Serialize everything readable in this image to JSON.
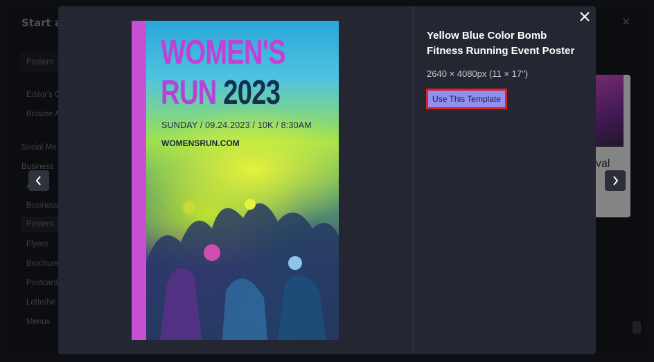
{
  "background": {
    "title": "Start a",
    "sidebar_items": [
      {
        "label": "Posters",
        "kind": "box"
      },
      {
        "label": "Editor's C"
      },
      {
        "label": "Browse A"
      },
      {
        "label": "Social Me",
        "kind": "section"
      },
      {
        "label": "Business",
        "kind": "section"
      },
      {
        "label": "A",
        "kind": "partial"
      },
      {
        "label": "Business"
      },
      {
        "label": "Posters",
        "kind": "active"
      },
      {
        "label": "Flyers"
      },
      {
        "label": "Brochure"
      },
      {
        "label": "Postcard"
      },
      {
        "label": "Letterhe"
      },
      {
        "label": "Menus"
      }
    ],
    "card_text": "val"
  },
  "modal": {
    "close_icon": "close-icon",
    "prev_icon": "chevron-left-icon",
    "next_icon": "chevron-right-icon",
    "poster": {
      "line1": "WOMEN'S",
      "line2_a": "RUN ",
      "line2_b": "2023",
      "details": "SUNDAY / 09.24.2023 / 10K / 8:30AM",
      "url": "WOMENSRUN.COM"
    },
    "title": "Yellow Blue Color Bomb Fitness Running Event Poster",
    "size": "2640 × 4080px (11 × 17\")",
    "use_button": "Use This Template",
    "colors": {
      "accent_button": "#8f90f2",
      "highlight_border": "#e0201f",
      "modal_bg": "#242631"
    }
  }
}
